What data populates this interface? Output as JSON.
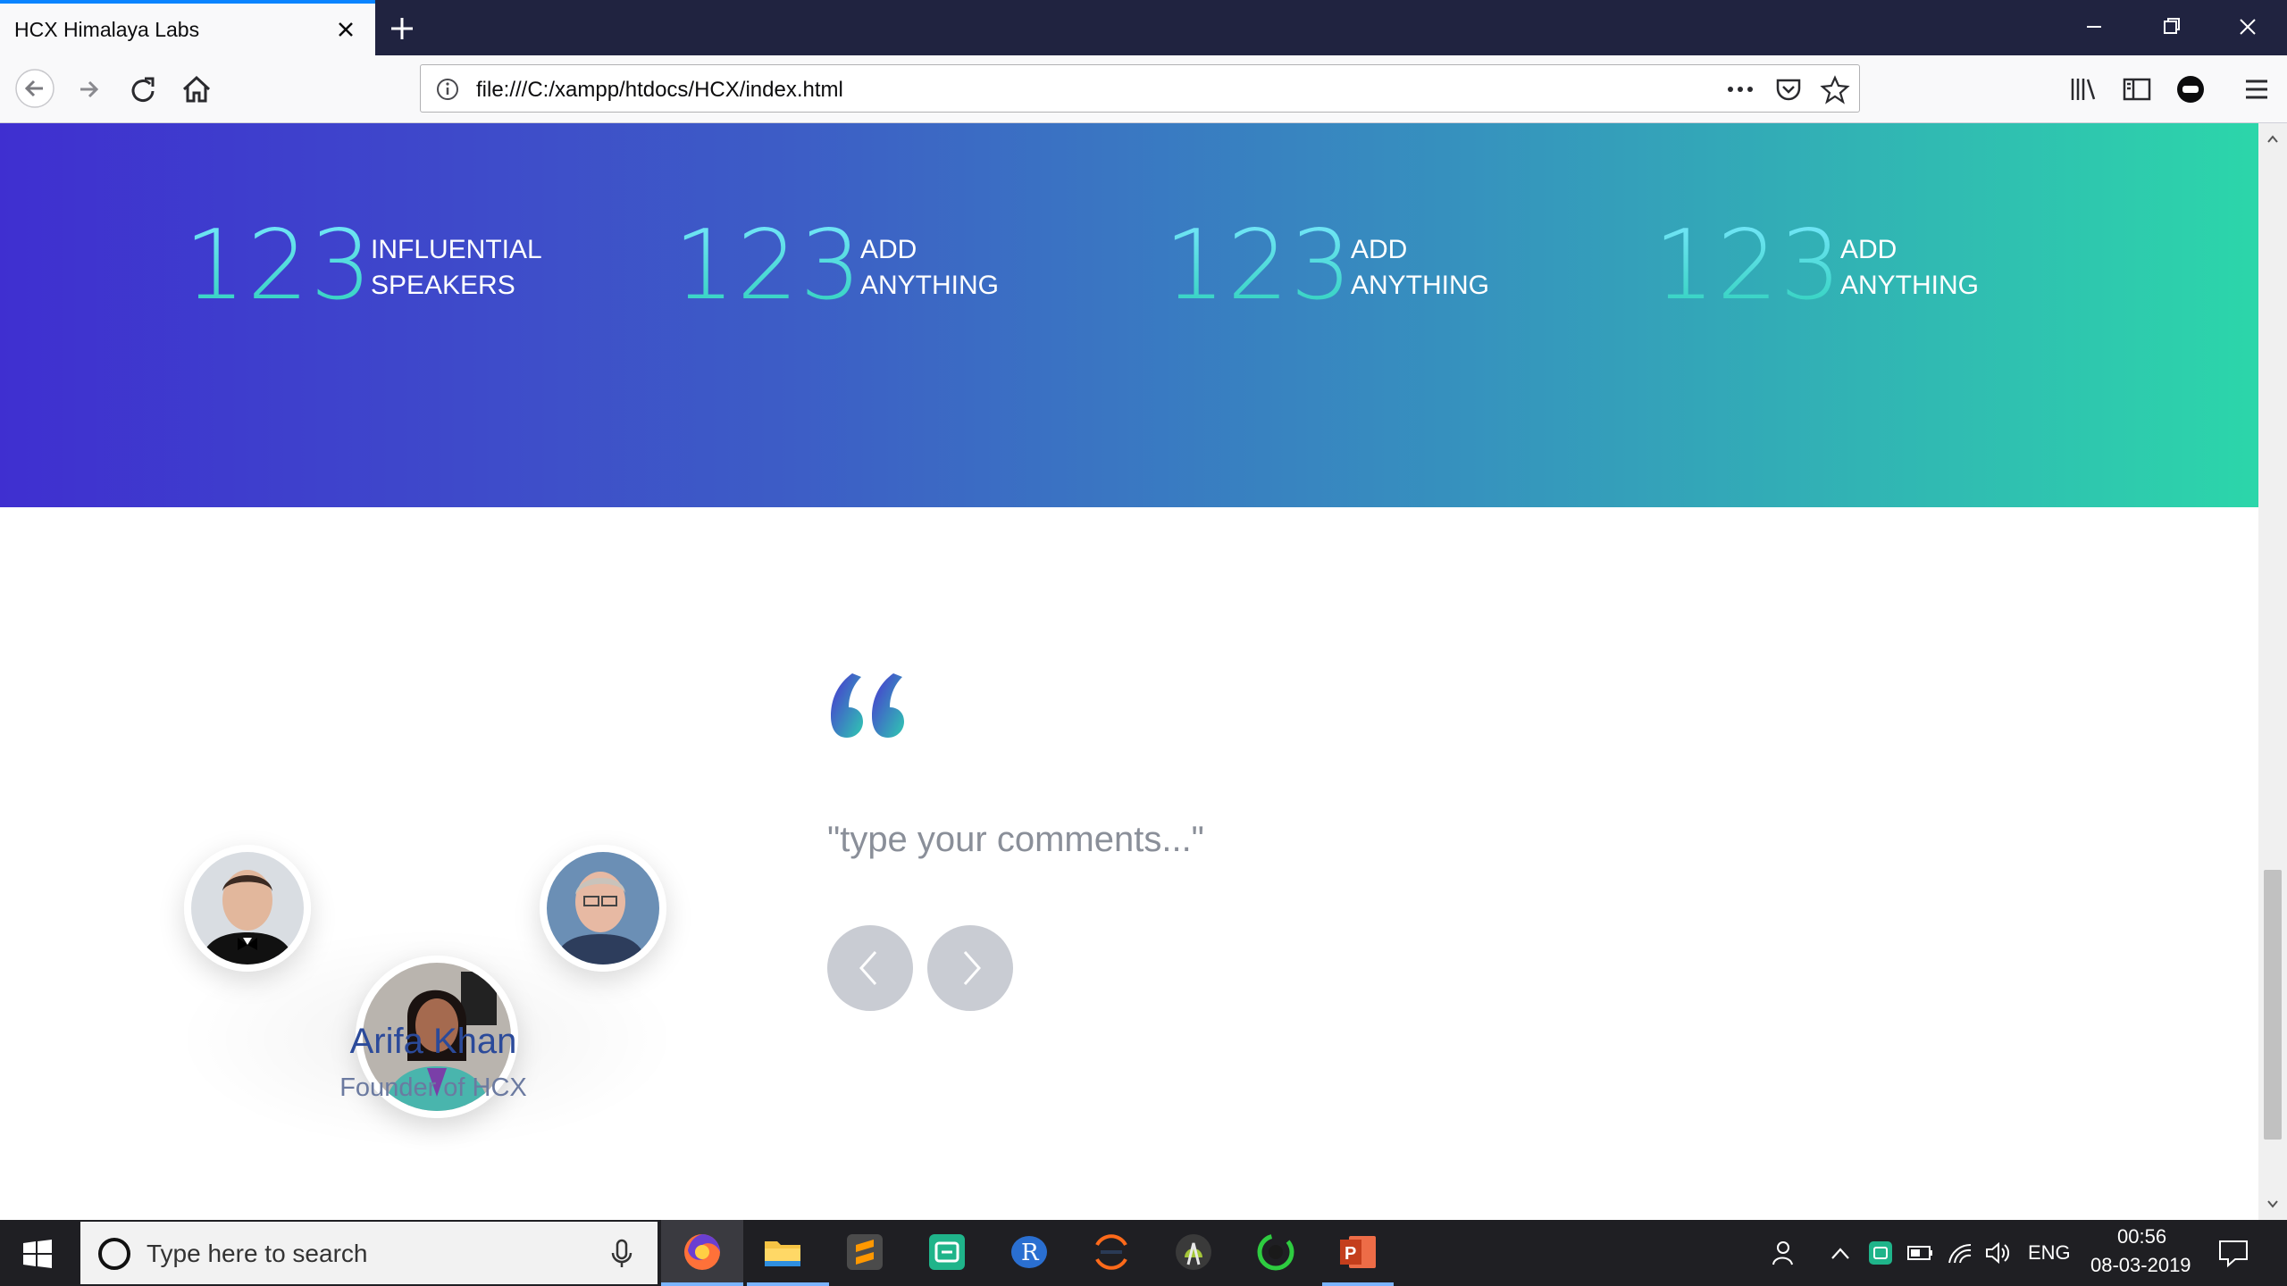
{
  "browser": {
    "tab_title": "HCX Himalaya Labs",
    "url": "file:///C:/xampp/htdocs/HCX/index.html"
  },
  "stats": [
    {
      "number": "123",
      "line1": "INFLUENTIAL",
      "line2": "SPEAKERS"
    },
    {
      "number": "123",
      "line1": "ADD",
      "line2": "ANYTHING"
    },
    {
      "number": "123",
      "line1": "ADD",
      "line2": "ANYTHING"
    },
    {
      "number": "123",
      "line1": "ADD",
      "line2": "ANYTHING"
    }
  ],
  "testimonial": {
    "comment": "\"type your comments...\"",
    "name": "Arifa Khan",
    "role": "Founder of HCX"
  },
  "taskbar": {
    "search_placeholder": "Type here to search",
    "language": "ENG",
    "time": "00:56",
    "date": "08-03-2019"
  },
  "colors": {
    "gradient_start": "#3f2fd0",
    "gradient_end": "#2cd6aa",
    "name_color": "#2b4a9a"
  }
}
